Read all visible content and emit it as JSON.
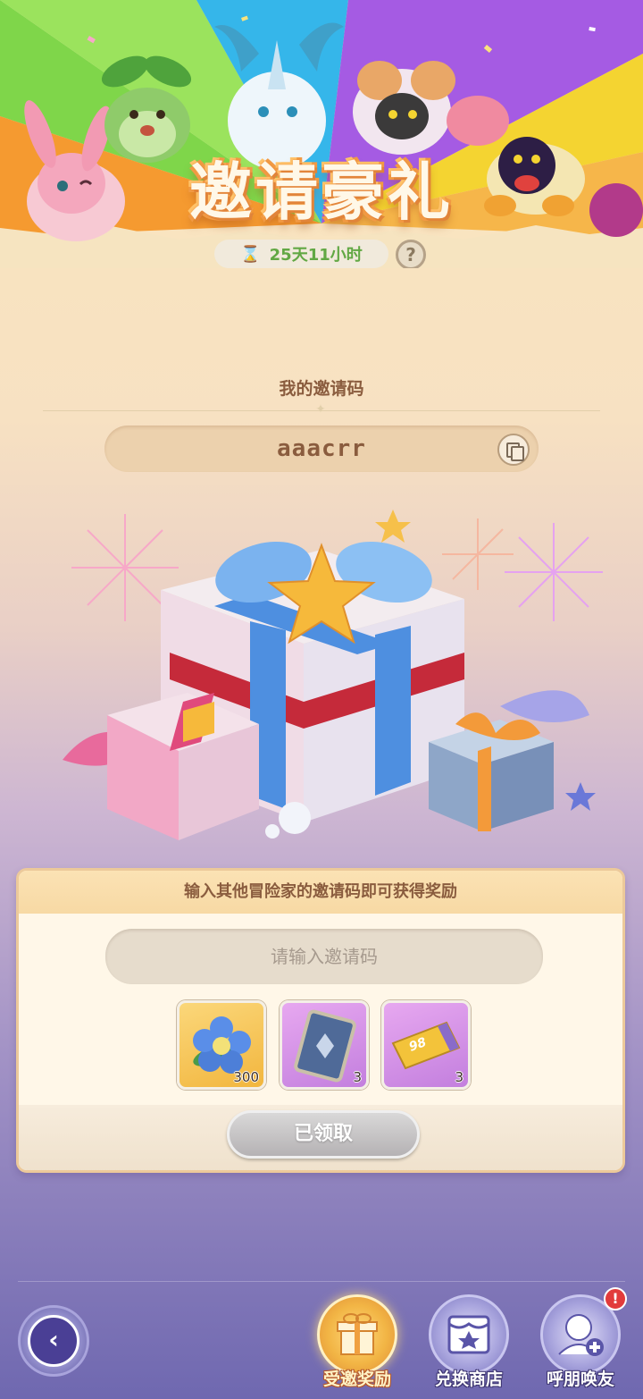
{
  "banner": {
    "title": "邀请豪礼",
    "timer": "25天11小时",
    "help_label": "?"
  },
  "my_code": {
    "label": "我的邀请码",
    "value": "aaacrr"
  },
  "redeem_panel": {
    "header": "输入其他冒险家的邀请码即可获得奖励",
    "input_placeholder": "请输入邀请码",
    "rewards": [
      {
        "icon": "blue-flower-icon",
        "count": "300"
      },
      {
        "icon": "card-icon",
        "count": "3"
      },
      {
        "icon": "ticket-icon",
        "count": "3",
        "ticket_text": "98"
      }
    ],
    "claimed_label": "已领取"
  },
  "bottom_nav": {
    "items": [
      {
        "label": "受邀奖励",
        "icon": "gift-icon",
        "active": true
      },
      {
        "label": "兑换商店",
        "icon": "shop-icon",
        "active": false
      },
      {
        "label": "呼朋唤友",
        "icon": "invite-friend-icon",
        "active": false,
        "badge": "!"
      }
    ]
  },
  "colors": {
    "accent_brown": "#8a5c3e",
    "timer_green": "#62a844",
    "badge_red": "#e23b3b"
  }
}
